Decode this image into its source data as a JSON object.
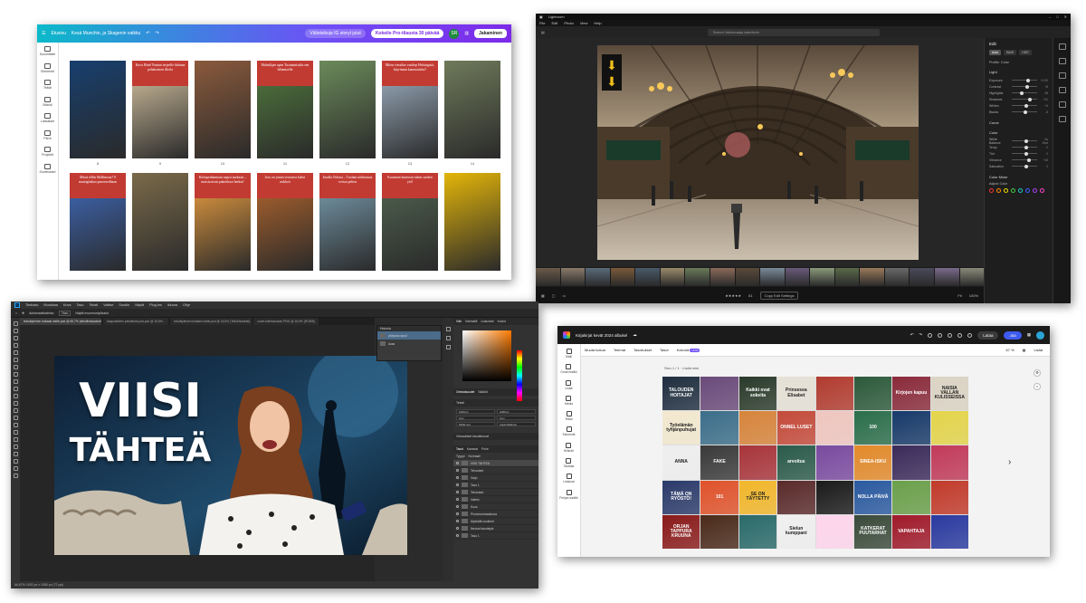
{
  "canva": {
    "home": "Etusivu",
    "doc_title": "Kesä Munchin, ja Skagenin vatkku",
    "resize": "Väliotsikoja IG storyt jutut",
    "pro_cta": "Kokeile Pro-tilausta 30 päivää",
    "avatar": "SR",
    "share": "Jakaminen",
    "sidebar": [
      "Suunnittele",
      "Elementit",
      "Teksti",
      "Brändi",
      "Lataukset",
      "Piirrä",
      "Projektit",
      "Sovellukset"
    ],
    "pages": [
      {
        "num": "8",
        "title": "",
        "color": "#173f6e"
      },
      {
        "num": "9",
        "title": "Kuva Hotel Pantun terjeelle hibinna pahakaisten illerla",
        "color": "#b7a88c"
      },
      {
        "num": "10",
        "title": "",
        "color": "#8a5a3c"
      },
      {
        "num": "11",
        "title": "Muhsilijan upea Tusinainisalta sen hilumiselle",
        "color": "#4a6b3a"
      },
      {
        "num": "12",
        "title": "",
        "color": "#6b8a5a"
      },
      {
        "num": "13",
        "title": "Miten vieralise vuoltep Helsingistä, käyrinaan kaunnaisiiin?",
        "color": "#8a99a8"
      },
      {
        "num": "14",
        "title": "",
        "color": "#6f7a5a"
      },
      {
        "num": "",
        "title": "Missä iéllin Mallimoaa? 8 mustigiinkaa panoruedhaan",
        "color": "#3b5ea0"
      },
      {
        "num": "",
        "title": "",
        "color": "#7a6a4a"
      },
      {
        "num": "",
        "title": "Köönpenhantaun raqusi aurkaasi – muista nissä paketihaoi herkut!",
        "color": "#c98a3c"
      },
      {
        "num": "",
        "title": "Joss on jouset seuraava kahvi mikkeä",
        "color": "#9a5b2c"
      },
      {
        "num": "",
        "title": "Juralla Oslossi – Tuolani näiluninoa ovissa pelien",
        "color": "#6c8a99"
      },
      {
        "num": "",
        "title": "Kuumoin luontoan tuhon saoden yöt!",
        "color": "#4a5a4a"
      },
      {
        "num": "",
        "title": "",
        "color": "#e3b509"
      }
    ]
  },
  "lightroom": {
    "app_title": "Lightroom",
    "menu": [
      "File",
      "Edit",
      "Photo",
      "View",
      "Help"
    ],
    "search_placeholder": "Search Valokuvaaja kalenterin",
    "panel_title": "Edit",
    "panel_tabs": [
      "Auto",
      "B&W",
      "HDR"
    ],
    "profile": "Profile: Color",
    "section_light": "Light",
    "sliders": [
      {
        "label": "Exposure",
        "value": "+0.30",
        "pos": 0.56
      },
      {
        "label": "Contrast",
        "value": "+8",
        "pos": 0.52
      },
      {
        "label": "Highlights",
        "value": "-38",
        "pos": 0.31
      },
      {
        "label": "Shadows",
        "value": "+31",
        "pos": 0.66
      },
      {
        "label": "Whites",
        "value": "+4",
        "pos": 0.51
      },
      {
        "label": "Blacks",
        "value": "-8",
        "pos": 0.46
      }
    ],
    "section_curve": "Curve",
    "section_color": "Color",
    "color_sliders": [
      {
        "label": "White Balance",
        "value": "As Shot",
        "pos": 0.5
      },
      {
        "label": "Temp",
        "value": "0",
        "pos": 0.5
      },
      {
        "label": "Tint",
        "value": "0",
        "pos": 0.5
      },
      {
        "label": "Vibrance",
        "value": "+18",
        "pos": 0.59
      },
      {
        "label": "Saturation",
        "value": "0",
        "pos": 0.5
      }
    ],
    "section_mixer": "Color Mixer",
    "adjust": "Adjust: Color",
    "dot_colors": [
      "#e33",
      "#f80",
      "#ed0",
      "#4c4",
      "#2cc",
      "#36f",
      "#a4f",
      "#f4c"
    ],
    "rating_count": "81",
    "copy_settings": "Copy Edit Settings",
    "fit": "Fit",
    "zoom": "100%"
  },
  "photoshop": {
    "menu": [
      "Tiedosto",
      "Muokkaa",
      "Kuva",
      "Taso",
      "Teksti",
      "Valitse",
      "Suodin",
      "Näytä",
      "Plug-ins",
      "Ikkuna",
      "Ohje"
    ],
    "options": [
      "Automaattivalinta:",
      "Taso",
      "Näytä muunnustyökalut"
    ],
    "tabs": [
      "tekoälyleinen kollaasi webb.psd @ 66,7% (tekstilinksadverbintotsoa)...",
      "kaapusilivien pelselistot-psd.psd @ 16,5%...",
      "tekoälyleinen kollaasi webb.psd @ 16,5% (TeiKaSiadesti)...",
      "cover-kilentauntum PNG @ 16,5% (RGB/8)"
    ],
    "thumb_line1": "VIISI",
    "thumb_line2": "TÄHTEÄ",
    "status": "66,67%   1920 px x 1080 px (72 ppi)",
    "history_title": "Historia",
    "history_items": [
      "yllätyskuvapsd",
      "Avaa"
    ],
    "color_tabs": [
      "Väri",
      "Värimallit",
      "Liukuvärit",
      "Kuviot"
    ],
    "props_tabs": [
      "Ominaisuudet",
      "Säädöt"
    ],
    "props_section": "Teksti",
    "fields": [
      "1920 px",
      "1080 px",
      "0 px",
      "0 px",
      "Möllö-veri",
      "Lapioshilainen"
    ],
    "paragraph": "Virtuaaliset tasoikkunat",
    "layers_tabs": [
      "Tasot",
      "Kanavat",
      "Polut"
    ],
    "layers_kind": "Tyyppi",
    "layers_blend": "Normaali",
    "layers": [
      "VIISI TÄHTEÄ",
      "Tehosteet",
      "Varjo",
      "Taso 1",
      "Tehosteet",
      "Valmis",
      "Kuva",
      "Photomontaasikuva",
      "Älykkäät suotimet",
      "Neutral tasotstyle",
      "Taso 1"
    ]
  },
  "express": {
    "doc_title": "Kirjakirjat kevät 2024 albukel",
    "share_btn": "Lataa",
    "collab_btn": "Jaa",
    "tool_items": [
      "Muuta kokoa",
      "Teemat",
      "Tasoitukset",
      "Tasot",
      "Kokonä"
    ],
    "tool_badge": "UUSI",
    "zoom": "67 %",
    "extra": "Lisää",
    "sidebar": [
      "Malli",
      "Omat mallisi",
      "Lisää",
      "Media",
      "Teksti",
      "Elementit",
      "Brändit",
      "Taustaa",
      "Lisäosat",
      "Pohjan sisältö"
    ],
    "page_label": "Sivu 1 / 1 · Lisää nimi",
    "covers": [
      {
        "text": "TALOUDEN HOITAJAT",
        "color": "#1f2e3f"
      },
      {
        "text": "",
        "color": "#6a4a7a"
      },
      {
        "text": "Kaikki ovat sokeita",
        "color": "#2a3a2a"
      },
      {
        "text": "Prinsessa Elisabet",
        "color": "#e6e1d6"
      },
      {
        "text": "",
        "color": "#b23b2f"
      },
      {
        "text": "",
        "color": "#2c5a3a"
      },
      {
        "text": "Kirjojen kapuu",
        "color": "#8a2a3a"
      },
      {
        "text": "NAISIA VALLAN KULISSEISSA",
        "color": "#dcd4c4"
      },
      {
        "text": "Työelämän tyhjänpuhujat",
        "color": "#f3e9cf"
      },
      {
        "text": "",
        "color": "#3b6e8a"
      },
      {
        "text": "",
        "color": "#d7843a"
      },
      {
        "text": "ONNEL LUSET",
        "color": "#c44a3a"
      },
      {
        "text": "",
        "color": "#f0c6c0"
      },
      {
        "text": "100",
        "color": "#2a6e4a"
      },
      {
        "text": "",
        "color": "#173a6a"
      },
      {
        "text": "",
        "color": "#e4d54a"
      },
      {
        "text": "ANNA",
        "color": "#efefef"
      },
      {
        "text": "FAKE",
        "color": "#3a3a3a"
      },
      {
        "text": "",
        "color": "#a8343a"
      },
      {
        "text": "arvoitus",
        "color": "#2a5a4a"
      },
      {
        "text": "",
        "color": "#7a4aa0"
      },
      {
        "text": "SINEA-ISKU",
        "color": "#e38a2a"
      },
      {
        "text": "",
        "color": "#3a2a5a"
      },
      {
        "text": "",
        "color": "#c23a5a"
      },
      {
        "text": "TÄMÄ ON RYÖSTÖ!",
        "color": "#2a3a6a"
      },
      {
        "text": "101",
        "color": "#e0522a"
      },
      {
        "text": "SE ON TÄYTETTY",
        "color": "#f2b72a"
      },
      {
        "text": "",
        "color": "#5a2a2a"
      },
      {
        "text": "",
        "color": "#1a1a1a"
      },
      {
        "text": "NOLLA PÄIVÄ",
        "color": "#2a5aa0"
      },
      {
        "text": "",
        "color": "#6aa04a"
      },
      {
        "text": "",
        "color": "#c23a2a"
      },
      {
        "text": "ORJAN TAPPURA KRUUNA",
        "color": "#8a1a1a"
      },
      {
        "text": "",
        "color": "#4a2a1a"
      },
      {
        "text": "",
        "color": "#2a6a6a"
      },
      {
        "text": "Sielun kumppani",
        "color": "#f0f0f0"
      },
      {
        "text": "",
        "color": "#ffd6ec"
      },
      {
        "text": "KATKERAT PUUTARHAT",
        "color": "#3a4a3a"
      },
      {
        "text": "VAPAHTAJA",
        "color": "#a01a2a"
      },
      {
        "text": "",
        "color": "#2a3aa0"
      }
    ]
  }
}
